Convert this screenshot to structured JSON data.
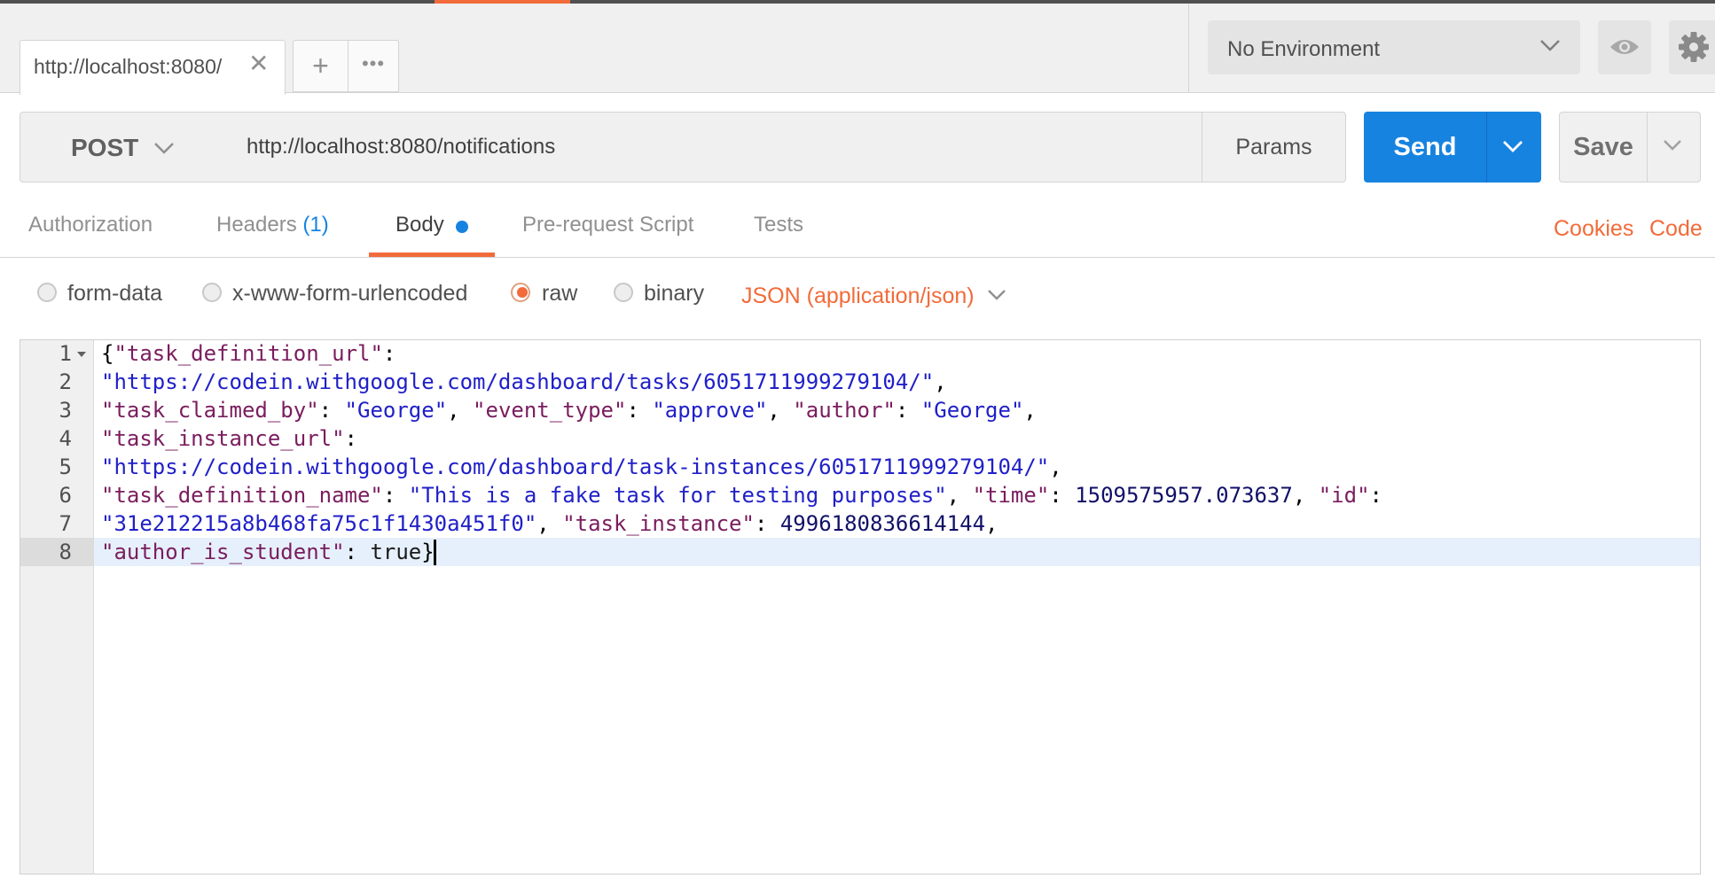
{
  "tabs": {
    "active_tab_label": "http://localhost:8080/",
    "close_glyph": "✕",
    "add_glyph": "+",
    "more_glyph": "•••"
  },
  "environment": {
    "selected": "No Environment",
    "icons": [
      "chevron-down-icon",
      "eye-icon",
      "gear-icon"
    ]
  },
  "request": {
    "method": "POST",
    "url": "http://localhost:8080/notifications",
    "params_label": "Params",
    "send_label": "Send",
    "save_label": "Save"
  },
  "request_tabs": {
    "authorization": "Authorization",
    "headers": "Headers",
    "headers_count": "(1)",
    "body": "Body",
    "prerequest": "Pre-request Script",
    "tests": "Tests",
    "cookies": "Cookies",
    "code": "Code"
  },
  "body_modes": {
    "form_data": "form-data",
    "urlencoded": "x-www-form-urlencoded",
    "raw": "raw",
    "binary": "binary",
    "selected": "raw",
    "content_type": "JSON (application/json)"
  },
  "editor": {
    "line_numbers": [
      "1",
      "2",
      "3",
      "4",
      "5",
      "6",
      "7",
      "8"
    ],
    "active_line": 8,
    "tokens": {
      "l1_brace": "{",
      "l1_key": "\"task_definition_url\"",
      "l1_colon": ":",
      "l2_val": "\"https://codein.withgoogle.com/dashboard/tasks/6051711999279104/\"",
      "l2_comma": ",",
      "l3_key1": "\"task_claimed_by\"",
      "l3_sep1": ": ",
      "l3_val1": "\"George\"",
      "l3_sep2": ", ",
      "l3_key2": "\"event_type\"",
      "l3_sep3": ": ",
      "l3_val2": "\"approve\"",
      "l3_sep4": ", ",
      "l3_key3": "\"author\"",
      "l3_sep5": ": ",
      "l3_val3": "\"George\"",
      "l3_end": ",",
      "l4_key": "\"task_instance_url\"",
      "l4_colon": ":",
      "l5_val": "\"https://codein.withgoogle.com/dashboard/task-instances/6051711999279104/\"",
      "l5_comma": ",",
      "l6_key1": "\"task_definition_name\"",
      "l6_sep1": ": ",
      "l6_val1": "\"This is a fake task for testing purposes\"",
      "l6_sep2": ", ",
      "l6_key2": "\"time\"",
      "l6_sep3": ": ",
      "l6_num": "1509575957.073637",
      "l6_sep4": ", ",
      "l6_key3": "\"id\"",
      "l6_colon": ":",
      "l7_val1": "\"31e212215a8b468fa75c1f1430a451f0\"",
      "l7_sep1": ", ",
      "l7_key": "\"task_instance\"",
      "l7_sep2": ": ",
      "l7_num": "4996180836614144",
      "l7_end": ",",
      "l8_key": "\"author_is_student\"",
      "l8_sep": ": ",
      "l8_val": "true",
      "l8_brace": "}"
    }
  },
  "colors": {
    "accent": "#f26b3a",
    "send_blue": "#1783e0",
    "json_key": "#7a1d5e",
    "json_string": "#2020c8",
    "json_number": "#101068"
  }
}
